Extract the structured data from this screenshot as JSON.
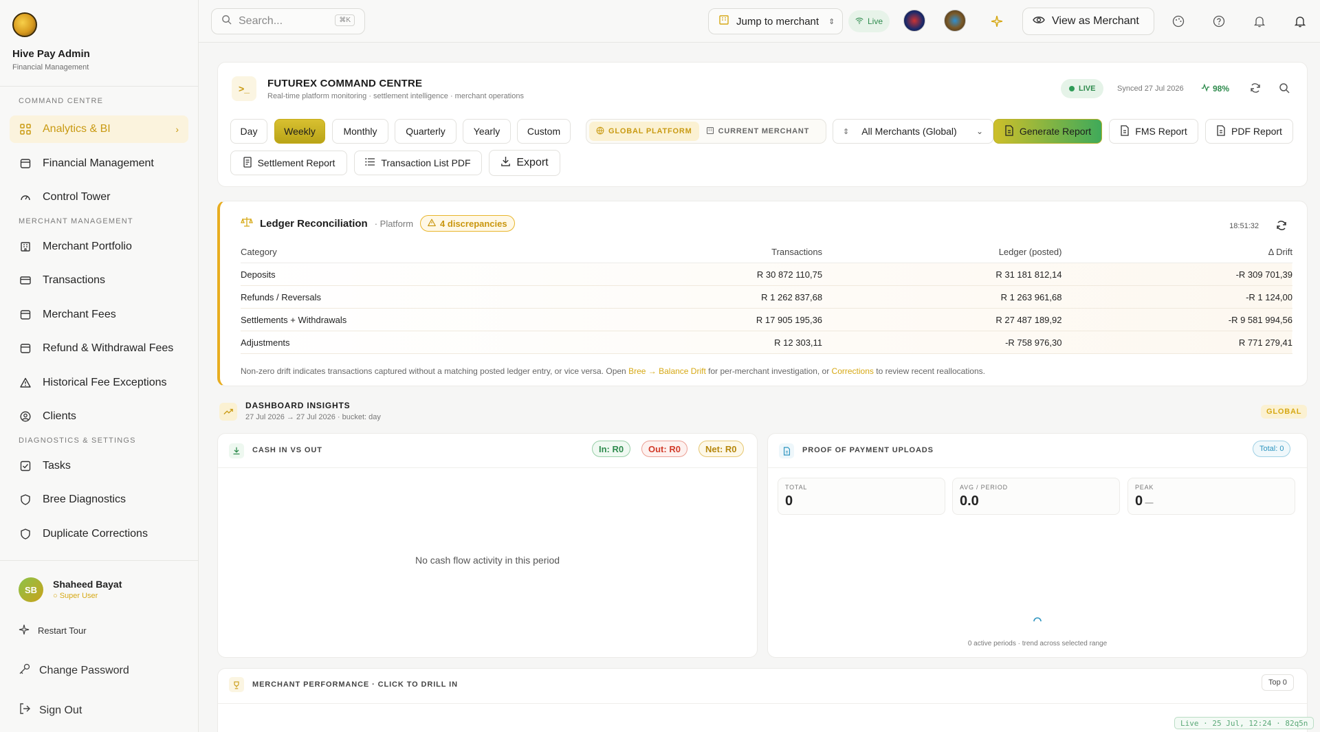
{
  "sidebar": {
    "brand_title": "Hive Pay Admin",
    "brand_sub": "Financial Management",
    "sections": [
      "COMMAND CENTRE",
      "MERCHANT MANAGEMENT",
      "DIAGNOSTICS & SETTINGS"
    ],
    "items": [
      {
        "label": "Analytics & BI",
        "icon": "grid-icon",
        "active": true
      },
      {
        "label": "Financial Management",
        "icon": "wallet-icon"
      },
      {
        "label": "Control Tower",
        "icon": "gauge-icon"
      },
      {
        "label": "Merchant Portfolio",
        "icon": "building-icon"
      },
      {
        "label": "Transactions",
        "icon": "card-icon"
      },
      {
        "label": "Merchant Fees",
        "icon": "wallet-icon"
      },
      {
        "label": "Refund & Withdrawal Fees",
        "icon": "wallet-icon"
      },
      {
        "label": "Historical Fee Exceptions",
        "icon": "warning-icon"
      },
      {
        "label": "Clients",
        "icon": "user-circle-icon"
      },
      {
        "label": "Tasks",
        "icon": "checkbox-icon"
      },
      {
        "label": "Bree Diagnostics",
        "icon": "shield-icon"
      },
      {
        "label": "Duplicate Corrections",
        "icon": "shield-icon"
      }
    ],
    "user": {
      "initials": "SB",
      "name": "Shaheed Bayat",
      "role": "Super User"
    },
    "actions": {
      "restart_tour": "Restart Tour",
      "change_password": "Change Password",
      "sign_out": "Sign Out"
    }
  },
  "topbar": {
    "search_placeholder": "Search...",
    "search_kbd": "⌘K",
    "jump_label": "Jump to merchant",
    "live_label": "Live",
    "view_as_merchant": "View as Merchant"
  },
  "command_centre": {
    "title": "FUTUREX COMMAND CENTRE",
    "subtitle": "Real-time platform monitoring · settlement intelligence · merchant operations",
    "live_badge": "LIVE",
    "synced": "Synced 27 Jul 2026",
    "health": "98%",
    "periods": [
      "Day",
      "Weekly",
      "Monthly",
      "Quarterly",
      "Yearly",
      "Custom"
    ],
    "selected_period": "Weekly",
    "scope_global": "GLOBAL PLATFORM",
    "scope_current": "CURRENT MERCHANT",
    "merchant_select": "All Merchants (Global)",
    "buttons": {
      "generate": "Generate Report",
      "fms": "FMS Report",
      "pdf": "PDF Report",
      "settlement": "Settlement Report",
      "txn_pdf": "Transaction List PDF",
      "export": "Export"
    }
  },
  "ledger": {
    "title": "Ledger Reconciliation",
    "scope": "· Platform",
    "discrepancies": "4 discrepancies",
    "time": "18:51:32",
    "headers": {
      "category": "Category",
      "transactions": "Transactions",
      "ledger": "Ledger (posted)",
      "drift": "Δ Drift"
    },
    "rows": [
      {
        "category": "Deposits",
        "transactions": "R 30 872 110,75",
        "ledger": "R 31 181 812,14",
        "drift": "-R 309 701,39",
        "tone": "neg"
      },
      {
        "category": "Refunds / Reversals",
        "transactions": "R 1 262 837,68",
        "ledger": "R 1 263 961,68",
        "drift": "-R 1 124,00",
        "tone": "neg"
      },
      {
        "category": "Settlements + Withdrawals",
        "transactions": "R 17 905 195,36",
        "ledger": "R 27 487 189,92",
        "drift": "-R 9 581 994,56",
        "tone": "neg"
      },
      {
        "category": "Adjustments",
        "transactions": "R 12 303,11",
        "ledger": "-R 758 976,30",
        "drift": "R 771 279,41",
        "tone": "amb"
      }
    ],
    "note_pre": "Non-zero drift indicates transactions captured without a matching posted ledger entry, or vice versa. Open ",
    "note_link1": "Bree → Balance Drift",
    "note_mid": " for per-merchant investigation, or ",
    "note_link2": "Corrections",
    "note_post": " to review recent reallocations."
  },
  "insights": {
    "title": "DASHBOARD INSIGHTS",
    "subtitle": "27 Jul 2026 → 27 Jul 2026 · bucket: day",
    "scope": "GLOBAL",
    "cash": {
      "title": "CASH IN VS OUT",
      "in": "In: R0",
      "out": "Out: R0",
      "net": "Net: R0",
      "empty": "No cash flow activity in this period"
    },
    "pop": {
      "title": "PROOF OF PAYMENT UPLOADS",
      "total_pill": "Total: 0",
      "stats": [
        {
          "label": "TOTAL",
          "value": "0"
        },
        {
          "label": "AVG / PERIOD",
          "value": "0.0"
        },
        {
          "label": "PEAK",
          "value": "0"
        }
      ],
      "footer": "0 active periods · trend across selected range"
    },
    "merchant_perf": {
      "title": "MERCHANT PERFORMANCE · CLICK TO DRILL IN",
      "top": "Top 0"
    }
  },
  "status_tag": "Live · 25 Jul, 12:24 · 82q5n",
  "colors": {
    "accent": "#d6a814",
    "live_green": "#2e8b4d",
    "danger": "#d9412e"
  }
}
